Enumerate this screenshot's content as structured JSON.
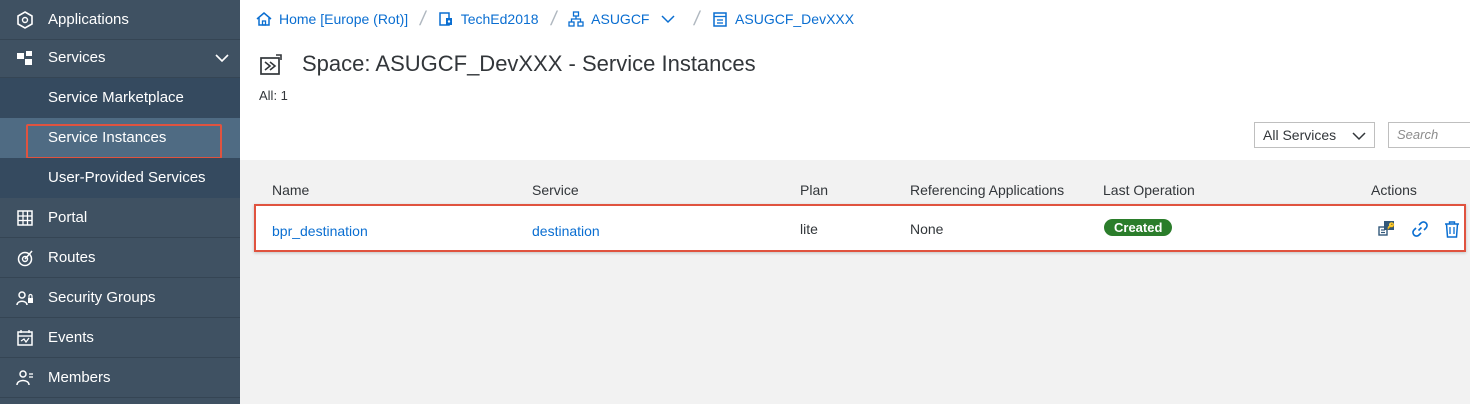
{
  "sidebar": {
    "items": [
      {
        "label": "Applications",
        "icon": "applications-icon"
      },
      {
        "label": "Services",
        "icon": "services-icon"
      },
      {
        "label": "Service Marketplace"
      },
      {
        "label": "Service Instances"
      },
      {
        "label": "User-Provided Services"
      },
      {
        "label": "Portal",
        "icon": "portal-icon"
      },
      {
        "label": "Routes",
        "icon": "routes-icon"
      },
      {
        "label": "Security Groups",
        "icon": "security-groups-icon"
      },
      {
        "label": "Events",
        "icon": "events-icon"
      },
      {
        "label": "Members",
        "icon": "members-icon"
      }
    ]
  },
  "breadcrumb": {
    "home": "Home [Europe (Rot)]",
    "subaccount": "TechEd2018",
    "org": "ASUGCF",
    "space": "ASUGCF_DevXXX"
  },
  "page": {
    "title": "Space: ASUGCF_DevXXX - Service Instances",
    "count": "All: 1"
  },
  "filters": {
    "service_select": "All Services",
    "search_placeholder": "Search"
  },
  "table": {
    "headers": [
      "Name",
      "Service",
      "Plan",
      "Referencing Applications",
      "Last Operation",
      "Actions"
    ],
    "rows": [
      {
        "name": "bpr_destination",
        "service": "destination",
        "plan": "lite",
        "referencing": "None",
        "last_operation": "Created"
      }
    ]
  },
  "colors": {
    "sidebar_bg": "#3f5162",
    "link": "#0a6ed1",
    "highlight": "#e0533f",
    "status_created": "#2b7d2b"
  }
}
